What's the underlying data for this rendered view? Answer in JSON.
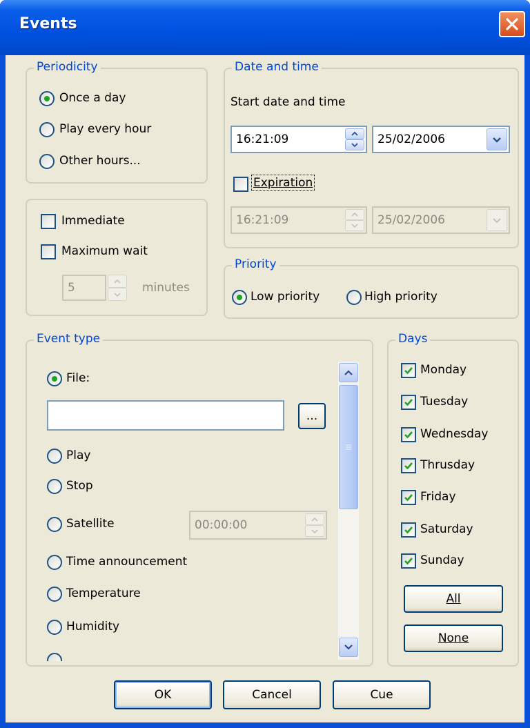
{
  "window": {
    "title": "Events"
  },
  "periodicity": {
    "legend": "Periodicity",
    "options": [
      "Once a day",
      "Play every hour",
      "Other hours..."
    ],
    "selected": "Once a day"
  },
  "wait": {
    "immediate_label": "Immediate",
    "immediate_checked": false,
    "maxwait_label": "Maximum wait",
    "maxwait_checked": false,
    "minutes_value": "5",
    "minutes_label": "minutes"
  },
  "datetime": {
    "legend": "Date and time",
    "start_label": "Start date and time",
    "start_time": "16:21:09",
    "start_date": "25/02/2006",
    "expiration_label": "Expiration",
    "expiration_checked": false,
    "exp_time": "16:21:09",
    "exp_date": "25/02/2006"
  },
  "priority": {
    "legend": "Priority",
    "options": [
      "Low priority",
      "High priority"
    ],
    "selected": "Low priority"
  },
  "event_type": {
    "legend": "Event type",
    "file_label": "File:",
    "file_value": "",
    "browse_label": "...",
    "play_label": "Play",
    "stop_label": "Stop",
    "satellite_label": "Satellite",
    "satellite_time": "00:00:00",
    "time_announcement_label": "Time announcement",
    "temperature_label": "Temperature",
    "humidity_label": "Humidity",
    "selected": "File:"
  },
  "days": {
    "legend": "Days",
    "items": [
      {
        "label": "Monday",
        "checked": true
      },
      {
        "label": "Tuesday",
        "checked": true
      },
      {
        "label": "Wednesday",
        "checked": true
      },
      {
        "label": "Thrusday",
        "checked": true
      },
      {
        "label": "Friday",
        "checked": true
      },
      {
        "label": "Saturday",
        "checked": true
      },
      {
        "label": "Sunday",
        "checked": true
      }
    ],
    "all_label": "All",
    "none_label": "None"
  },
  "footer": {
    "ok_label": "OK",
    "cancel_label": "Cancel",
    "cue_label": "Cue"
  },
  "colors": {
    "title_bar": "#0050e0",
    "dialog_bg": "#ece9d8",
    "legend_text": "#0046d5",
    "close_button": "#d74c1e",
    "check_mark": "#21a121"
  },
  "icons": [
    "close-icon",
    "spin-up-icon",
    "spin-down-icon",
    "chevron-down-icon",
    "scroll-up-icon",
    "scroll-down-icon",
    "check-icon"
  ]
}
